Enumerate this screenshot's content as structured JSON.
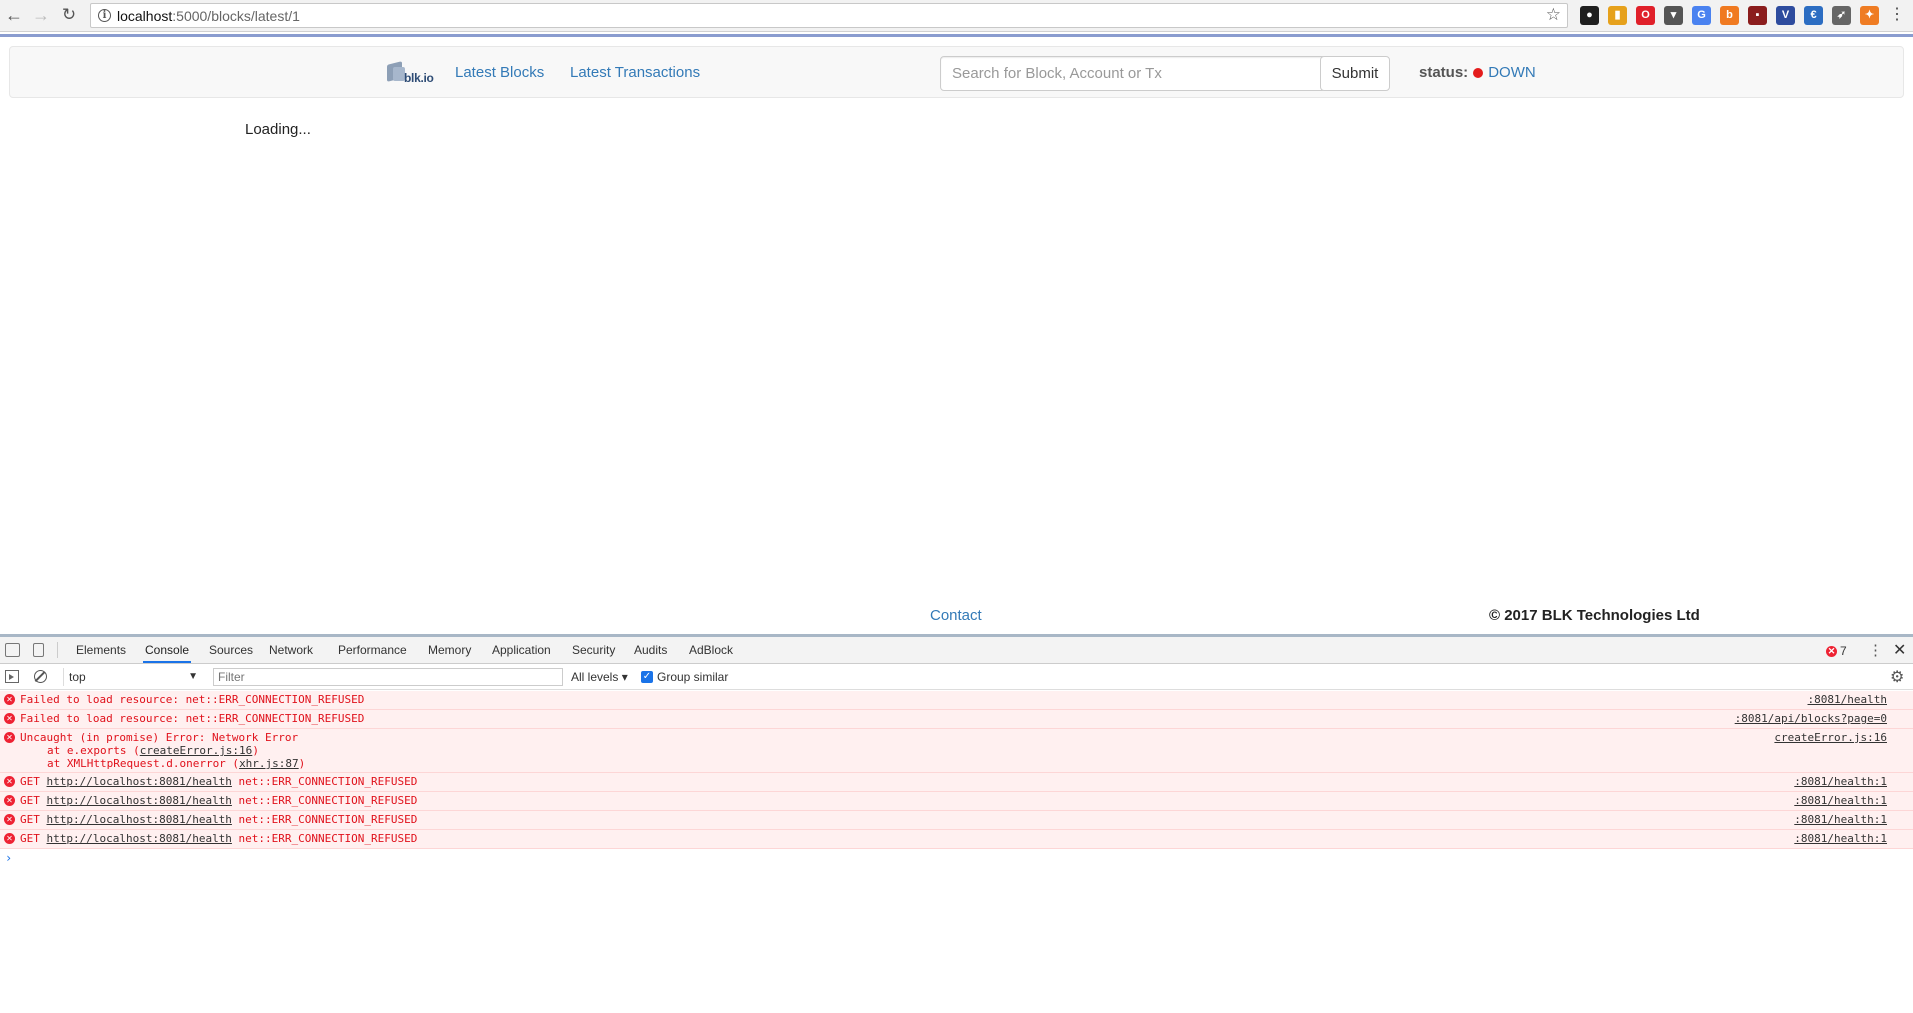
{
  "browser": {
    "url_host": "localhost",
    "url_path": ":5000/blocks/latest/1",
    "extensions": [
      {
        "name": "color-icon",
        "color": "#1f1f1f",
        "glyph": "●"
      },
      {
        "name": "chart-icon",
        "color": "#e6a11c",
        "glyph": "▮"
      },
      {
        "name": "opera-icon",
        "color": "#e0202a",
        "glyph": "O"
      },
      {
        "name": "pocket-icon",
        "color": "#555555",
        "glyph": "▾"
      },
      {
        "name": "translate-icon",
        "color": "#4a82f0",
        "glyph": "G"
      },
      {
        "name": "bitcoin-icon",
        "color": "#f07a21",
        "glyph": "b"
      },
      {
        "name": "book-icon",
        "color": "#8b1d1d",
        "glyph": "▪"
      },
      {
        "name": "vue-icon",
        "color": "#2e4c9e",
        "glyph": "V"
      },
      {
        "name": "euro-icon",
        "color": "#2c6dc2",
        "glyph": "€"
      },
      {
        "name": "rocket-icon",
        "color": "#666666",
        "glyph": "➶"
      },
      {
        "name": "metamask-icon",
        "color": "#ef7c23",
        "glyph": "✦"
      }
    ]
  },
  "navbar": {
    "logo_text": "blk.io",
    "links": [
      "Latest Blocks",
      "Latest Transactions"
    ],
    "search_placeholder": "Search for Block, Account or Tx",
    "submit_label": "Submit",
    "status_label": "status:",
    "status_value": "DOWN",
    "status_color": "#e41c1c"
  },
  "main": {
    "loading_text": "Loading..."
  },
  "footer": {
    "contact": "Contact",
    "copyright": "© 2017 BLK Technologies Ltd"
  },
  "devtools": {
    "tabs": [
      "Elements",
      "Console",
      "Sources",
      "Network",
      "Performance",
      "Memory",
      "Application",
      "Security",
      "Audits",
      "AdBlock"
    ],
    "active_tab": "Console",
    "error_count": "7",
    "context": "top",
    "filter_placeholder": "Filter",
    "levels": "All levels",
    "group_similar": "Group similar",
    "messages": [
      {
        "text": "Failed to load resource: net::ERR_CONNECTION_REFUSED",
        "source": ":8081/health"
      },
      {
        "text": "Failed to load resource: net::ERR_CONNECTION_REFUSED",
        "source": ":8081/api/blocks?page=0"
      },
      {
        "text": "Uncaught (in promise) Error: Network Error",
        "source": "createError.js:16",
        "stack": [
          {
            "prefix": "at e.exports (",
            "link": "createError.js:16",
            "suffix": ")"
          },
          {
            "prefix": "at XMLHttpRequest.d.onerror (",
            "link": "xhr.js:87",
            "suffix": ")"
          }
        ]
      },
      {
        "method": "GET",
        "url": "http://localhost:8081/health",
        "error": "net::ERR_CONNECTION_REFUSED",
        "source": ":8081/health:1"
      },
      {
        "method": "GET",
        "url": "http://localhost:8081/health",
        "error": "net::ERR_CONNECTION_REFUSED",
        "source": ":8081/health:1"
      },
      {
        "method": "GET",
        "url": "http://localhost:8081/health",
        "error": "net::ERR_CONNECTION_REFUSED",
        "source": ":8081/health:1"
      },
      {
        "method": "GET",
        "url": "http://localhost:8081/health",
        "error": "net::ERR_CONNECTION_REFUSED",
        "source": ":8081/health:1"
      }
    ],
    "prompt": "›"
  }
}
